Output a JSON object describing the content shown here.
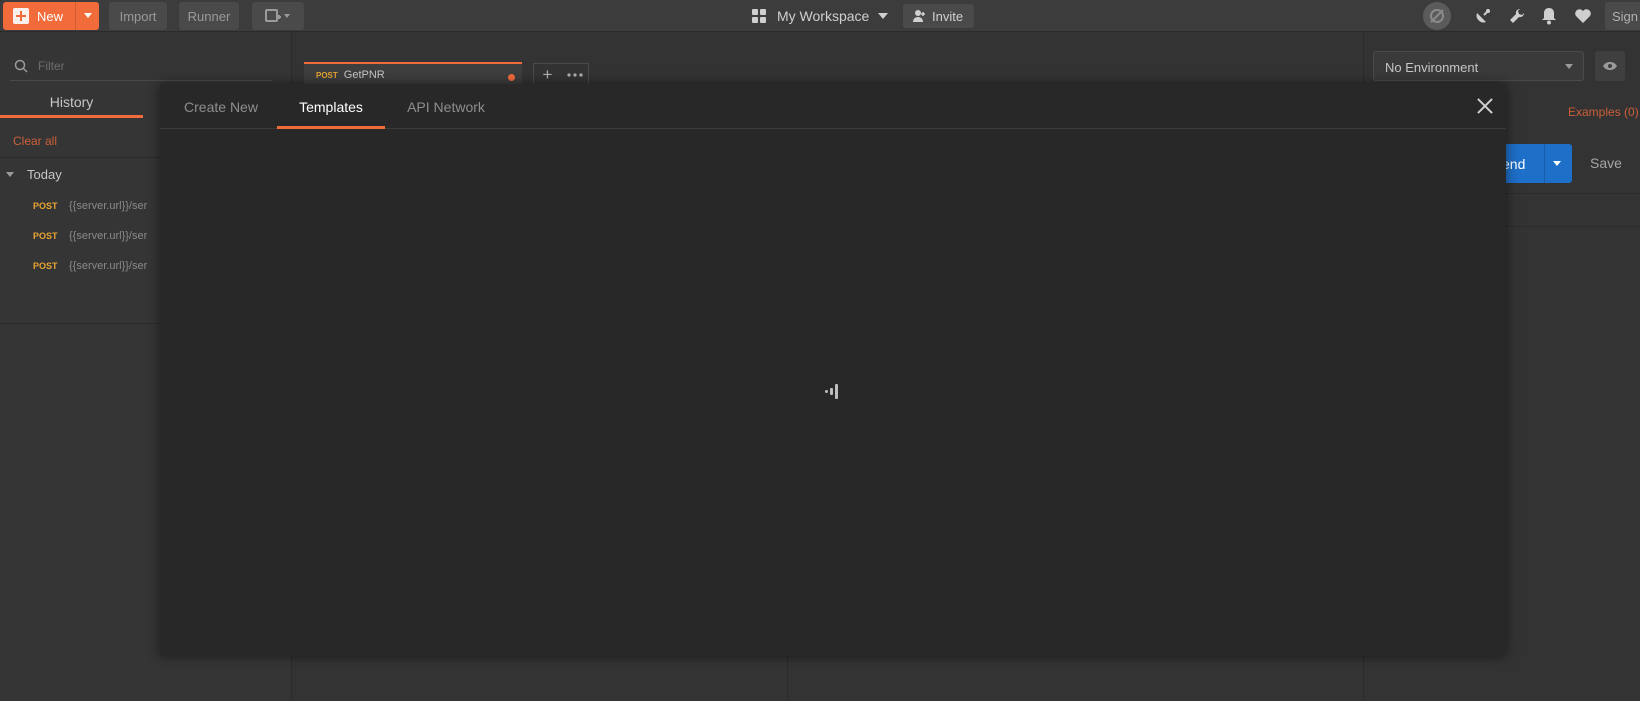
{
  "header": {
    "new_label": "New",
    "import_label": "Import",
    "runner_label": "Runner",
    "workspace_label": "My Workspace",
    "invite_label": "Invite",
    "sign_label": "Sign"
  },
  "sidebar": {
    "filter_placeholder": "Filter",
    "history_tab": "History",
    "clear_all": "Clear all",
    "group_label": "Today",
    "history_items": [
      {
        "method": "POST",
        "url": "{{server.url}}/ser"
      },
      {
        "method": "POST",
        "url": "{{server.url}}/ser"
      },
      {
        "method": "POST",
        "url": "{{server.url}}/ser"
      }
    ]
  },
  "request_tab": {
    "method": "POST",
    "name": "GetPNR"
  },
  "environment": {
    "selected": "No Environment"
  },
  "request_bar": {
    "examples": "Examples (0)",
    "send_label": "end",
    "save_label": "Save"
  },
  "modal": {
    "tabs": [
      {
        "label": "Create New",
        "active": false
      },
      {
        "label": "Templates",
        "active": true
      },
      {
        "label": "API Network",
        "active": false
      }
    ],
    "loading": true
  },
  "colors": {
    "accent": "#f26b3a",
    "send_blue": "#1e6fc8",
    "method_post": "#e8a433"
  },
  "icons": [
    "grid-icon",
    "invite-user-icon",
    "sync-off-icon",
    "satellite-icon",
    "wrench-icon",
    "bell-icon",
    "heart-icon",
    "search-icon",
    "eye-icon",
    "close-icon",
    "loading-icon"
  ]
}
